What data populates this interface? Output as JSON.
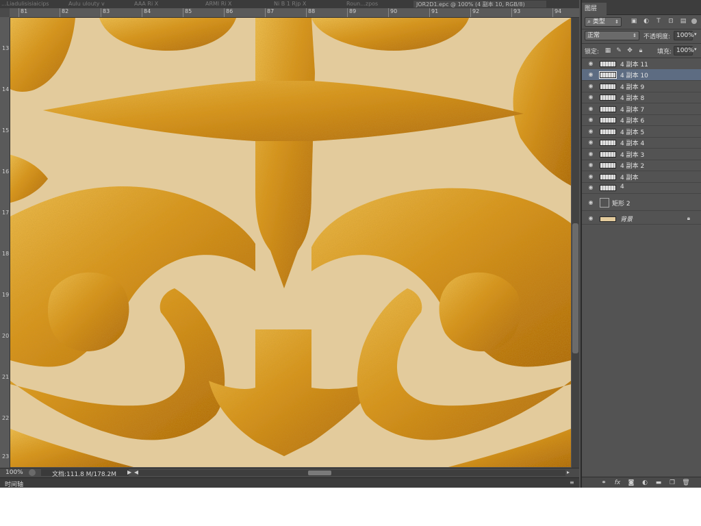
{
  "document": {
    "tabs": [
      {
        "label": "...Liadulisisiaicips",
        "active": false
      },
      {
        "label": "Aulu ulouty v",
        "active": false
      },
      {
        "label": "AAA  Ri  X",
        "active": false
      },
      {
        "label": "ARMl Ri  X",
        "active": false
      },
      {
        "label": "Ni B 1 Rjp X",
        "active": false
      },
      {
        "label": "Roun...zpos",
        "active": false
      },
      {
        "label": "JOR2D1.epc @ 100% (4 副本 10, RGB/8)",
        "active": true
      }
    ],
    "ruler_h_ticks": [
      "81",
      "82",
      "83",
      "84",
      "85",
      "86",
      "87",
      "88",
      "89",
      "90",
      "91",
      "92",
      "93",
      "94"
    ],
    "ruler_v_ticks": [
      "13",
      "14",
      "15",
      "16",
      "17",
      "18",
      "19",
      "20",
      "21",
      "22",
      "23"
    ]
  },
  "status": {
    "zoom": "100%",
    "doc_info": "文档:111.8 M/178.2M",
    "right_arrow": "▶",
    "left_arrow": "◀",
    "scroll_right": "▸"
  },
  "timeline": {
    "label": "时间轴",
    "menu": "≡"
  },
  "layers_panel": {
    "tab_label": "图层",
    "filter_label": "类型",
    "filter_icons": [
      "image-filter-icon",
      "adjustment-filter-icon",
      "type-filter-icon",
      "shape-filter-icon",
      "smart-object-filter-icon",
      "filter-toggle"
    ],
    "blend_mode": "正常",
    "opacity_label": "不透明度:",
    "opacity_value": "100%",
    "lock_label": "锁定:",
    "fill_label": "填充:",
    "fill_value": "100%",
    "layers": [
      {
        "name": "4 副本 11",
        "selected": false
      },
      {
        "name": "4 副本 10",
        "selected": true
      },
      {
        "name": "4 副本 9",
        "selected": false
      },
      {
        "name": "4 副本 8",
        "selected": false
      },
      {
        "name": "4 副本 7",
        "selected": false
      },
      {
        "name": "4 副本 6",
        "selected": false
      },
      {
        "name": "4 副本 5",
        "selected": false
      },
      {
        "name": "4 副本 4",
        "selected": false
      },
      {
        "name": "4 副本 3",
        "selected": false
      },
      {
        "name": "4 副本 2",
        "selected": false
      },
      {
        "name": "4 副本",
        "selected": false
      },
      {
        "name": "4",
        "selected": false
      }
    ],
    "shape_layer": "矩形 2",
    "background_layer": "背景"
  },
  "colors": {
    "canvas_bg": "#e3cb9c",
    "gold": "#d8921c",
    "gold_light": "#f2c356",
    "gold_dark": "#a9600c",
    "selected_layer": "#5d6c82"
  },
  "icons": {
    "eye": "eye-icon",
    "link": "link-layers-icon",
    "fx": "fx-icon",
    "mask": "mask-icon",
    "adjustment": "adjustment-layer-icon",
    "group": "folder-icon",
    "new_layer": "new-layer-icon",
    "delete": "trash-icon"
  }
}
